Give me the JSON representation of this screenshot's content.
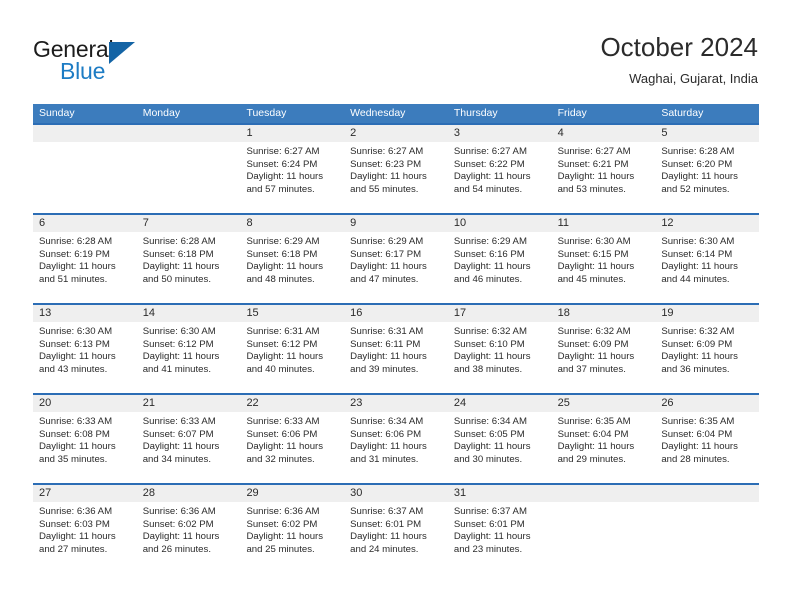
{
  "brand": {
    "word_one": "General",
    "word_two": "Blue",
    "flag_icon": "triangle-flag-icon",
    "blue_hex": "#1d7cc4",
    "flag_hex": "#1464a5"
  },
  "header": {
    "title": "October 2024",
    "subtitle": "Waghai, Gujarat, India"
  },
  "theme": {
    "header_row_bg": "#3c7cbd",
    "row_divider": "#2c6db5",
    "date_band_bg": "#efefef",
    "text": "#2b2b2b"
  },
  "weekdays": [
    "Sunday",
    "Monday",
    "Tuesday",
    "Wednesday",
    "Thursday",
    "Friday",
    "Saturday"
  ],
  "labels": {
    "sunrise_prefix": "Sunrise:",
    "sunset_prefix": "Sunset:",
    "daylight_prefix": "Daylight:"
  },
  "weeks": [
    [
      {
        "day": "",
        "empty": true
      },
      {
        "day": "",
        "empty": true
      },
      {
        "day": "1",
        "sunrise": "Sunrise: 6:27 AM",
        "sunset": "Sunset: 6:24 PM",
        "daylight1": "Daylight: 11 hours",
        "daylight2": "and 57 minutes."
      },
      {
        "day": "2",
        "sunrise": "Sunrise: 6:27 AM",
        "sunset": "Sunset: 6:23 PM",
        "daylight1": "Daylight: 11 hours",
        "daylight2": "and 55 minutes."
      },
      {
        "day": "3",
        "sunrise": "Sunrise: 6:27 AM",
        "sunset": "Sunset: 6:22 PM",
        "daylight1": "Daylight: 11 hours",
        "daylight2": "and 54 minutes."
      },
      {
        "day": "4",
        "sunrise": "Sunrise: 6:27 AM",
        "sunset": "Sunset: 6:21 PM",
        "daylight1": "Daylight: 11 hours",
        "daylight2": "and 53 minutes."
      },
      {
        "day": "5",
        "sunrise": "Sunrise: 6:28 AM",
        "sunset": "Sunset: 6:20 PM",
        "daylight1": "Daylight: 11 hours",
        "daylight2": "and 52 minutes."
      }
    ],
    [
      {
        "day": "6",
        "sunrise": "Sunrise: 6:28 AM",
        "sunset": "Sunset: 6:19 PM",
        "daylight1": "Daylight: 11 hours",
        "daylight2": "and 51 minutes."
      },
      {
        "day": "7",
        "sunrise": "Sunrise: 6:28 AM",
        "sunset": "Sunset: 6:18 PM",
        "daylight1": "Daylight: 11 hours",
        "daylight2": "and 50 minutes."
      },
      {
        "day": "8",
        "sunrise": "Sunrise: 6:29 AM",
        "sunset": "Sunset: 6:18 PM",
        "daylight1": "Daylight: 11 hours",
        "daylight2": "and 48 minutes."
      },
      {
        "day": "9",
        "sunrise": "Sunrise: 6:29 AM",
        "sunset": "Sunset: 6:17 PM",
        "daylight1": "Daylight: 11 hours",
        "daylight2": "and 47 minutes."
      },
      {
        "day": "10",
        "sunrise": "Sunrise: 6:29 AM",
        "sunset": "Sunset: 6:16 PM",
        "daylight1": "Daylight: 11 hours",
        "daylight2": "and 46 minutes."
      },
      {
        "day": "11",
        "sunrise": "Sunrise: 6:30 AM",
        "sunset": "Sunset: 6:15 PM",
        "daylight1": "Daylight: 11 hours",
        "daylight2": "and 45 minutes."
      },
      {
        "day": "12",
        "sunrise": "Sunrise: 6:30 AM",
        "sunset": "Sunset: 6:14 PM",
        "daylight1": "Daylight: 11 hours",
        "daylight2": "and 44 minutes."
      }
    ],
    [
      {
        "day": "13",
        "sunrise": "Sunrise: 6:30 AM",
        "sunset": "Sunset: 6:13 PM",
        "daylight1": "Daylight: 11 hours",
        "daylight2": "and 43 minutes."
      },
      {
        "day": "14",
        "sunrise": "Sunrise: 6:30 AM",
        "sunset": "Sunset: 6:12 PM",
        "daylight1": "Daylight: 11 hours",
        "daylight2": "and 41 minutes."
      },
      {
        "day": "15",
        "sunrise": "Sunrise: 6:31 AM",
        "sunset": "Sunset: 6:12 PM",
        "daylight1": "Daylight: 11 hours",
        "daylight2": "and 40 minutes."
      },
      {
        "day": "16",
        "sunrise": "Sunrise: 6:31 AM",
        "sunset": "Sunset: 6:11 PM",
        "daylight1": "Daylight: 11 hours",
        "daylight2": "and 39 minutes."
      },
      {
        "day": "17",
        "sunrise": "Sunrise: 6:32 AM",
        "sunset": "Sunset: 6:10 PM",
        "daylight1": "Daylight: 11 hours",
        "daylight2": "and 38 minutes."
      },
      {
        "day": "18",
        "sunrise": "Sunrise: 6:32 AM",
        "sunset": "Sunset: 6:09 PM",
        "daylight1": "Daylight: 11 hours",
        "daylight2": "and 37 minutes."
      },
      {
        "day": "19",
        "sunrise": "Sunrise: 6:32 AM",
        "sunset": "Sunset: 6:09 PM",
        "daylight1": "Daylight: 11 hours",
        "daylight2": "and 36 minutes."
      }
    ],
    [
      {
        "day": "20",
        "sunrise": "Sunrise: 6:33 AM",
        "sunset": "Sunset: 6:08 PM",
        "daylight1": "Daylight: 11 hours",
        "daylight2": "and 35 minutes."
      },
      {
        "day": "21",
        "sunrise": "Sunrise: 6:33 AM",
        "sunset": "Sunset: 6:07 PM",
        "daylight1": "Daylight: 11 hours",
        "daylight2": "and 34 minutes."
      },
      {
        "day": "22",
        "sunrise": "Sunrise: 6:33 AM",
        "sunset": "Sunset: 6:06 PM",
        "daylight1": "Daylight: 11 hours",
        "daylight2": "and 32 minutes."
      },
      {
        "day": "23",
        "sunrise": "Sunrise: 6:34 AM",
        "sunset": "Sunset: 6:06 PM",
        "daylight1": "Daylight: 11 hours",
        "daylight2": "and 31 minutes."
      },
      {
        "day": "24",
        "sunrise": "Sunrise: 6:34 AM",
        "sunset": "Sunset: 6:05 PM",
        "daylight1": "Daylight: 11 hours",
        "daylight2": "and 30 minutes."
      },
      {
        "day": "25",
        "sunrise": "Sunrise: 6:35 AM",
        "sunset": "Sunset: 6:04 PM",
        "daylight1": "Daylight: 11 hours",
        "daylight2": "and 29 minutes."
      },
      {
        "day": "26",
        "sunrise": "Sunrise: 6:35 AM",
        "sunset": "Sunset: 6:04 PM",
        "daylight1": "Daylight: 11 hours",
        "daylight2": "and 28 minutes."
      }
    ],
    [
      {
        "day": "27",
        "sunrise": "Sunrise: 6:36 AM",
        "sunset": "Sunset: 6:03 PM",
        "daylight1": "Daylight: 11 hours",
        "daylight2": "and 27 minutes."
      },
      {
        "day": "28",
        "sunrise": "Sunrise: 6:36 AM",
        "sunset": "Sunset: 6:02 PM",
        "daylight1": "Daylight: 11 hours",
        "daylight2": "and 26 minutes."
      },
      {
        "day": "29",
        "sunrise": "Sunrise: 6:36 AM",
        "sunset": "Sunset: 6:02 PM",
        "daylight1": "Daylight: 11 hours",
        "daylight2": "and 25 minutes."
      },
      {
        "day": "30",
        "sunrise": "Sunrise: 6:37 AM",
        "sunset": "Sunset: 6:01 PM",
        "daylight1": "Daylight: 11 hours",
        "daylight2": "and 24 minutes."
      },
      {
        "day": "31",
        "sunrise": "Sunrise: 6:37 AM",
        "sunset": "Sunset: 6:01 PM",
        "daylight1": "Daylight: 11 hours",
        "daylight2": "and 23 minutes."
      },
      {
        "day": "",
        "empty": true
      },
      {
        "day": "",
        "empty": true
      }
    ]
  ]
}
